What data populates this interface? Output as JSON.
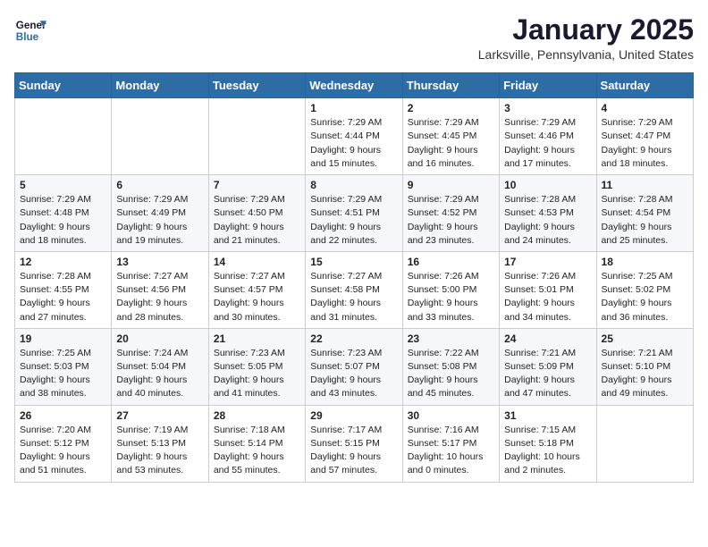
{
  "header": {
    "logo_line1": "General",
    "logo_line2": "Blue",
    "month": "January 2025",
    "location": "Larksville, Pennsylvania, United States"
  },
  "weekdays": [
    "Sunday",
    "Monday",
    "Tuesday",
    "Wednesday",
    "Thursday",
    "Friday",
    "Saturday"
  ],
  "weeks": [
    [
      {
        "day": "",
        "sunrise": "",
        "sunset": "",
        "daylight": ""
      },
      {
        "day": "",
        "sunrise": "",
        "sunset": "",
        "daylight": ""
      },
      {
        "day": "",
        "sunrise": "",
        "sunset": "",
        "daylight": ""
      },
      {
        "day": "1",
        "sunrise": "7:29 AM",
        "sunset": "4:44 PM",
        "daylight": "9 hours and 15 minutes."
      },
      {
        "day": "2",
        "sunrise": "7:29 AM",
        "sunset": "4:45 PM",
        "daylight": "9 hours and 16 minutes."
      },
      {
        "day": "3",
        "sunrise": "7:29 AM",
        "sunset": "4:46 PM",
        "daylight": "9 hours and 17 minutes."
      },
      {
        "day": "4",
        "sunrise": "7:29 AM",
        "sunset": "4:47 PM",
        "daylight": "9 hours and 18 minutes."
      }
    ],
    [
      {
        "day": "5",
        "sunrise": "7:29 AM",
        "sunset": "4:48 PM",
        "daylight": "9 hours and 18 minutes."
      },
      {
        "day": "6",
        "sunrise": "7:29 AM",
        "sunset": "4:49 PM",
        "daylight": "9 hours and 19 minutes."
      },
      {
        "day": "7",
        "sunrise": "7:29 AM",
        "sunset": "4:50 PM",
        "daylight": "9 hours and 21 minutes."
      },
      {
        "day": "8",
        "sunrise": "7:29 AM",
        "sunset": "4:51 PM",
        "daylight": "9 hours and 22 minutes."
      },
      {
        "day": "9",
        "sunrise": "7:29 AM",
        "sunset": "4:52 PM",
        "daylight": "9 hours and 23 minutes."
      },
      {
        "day": "10",
        "sunrise": "7:28 AM",
        "sunset": "4:53 PM",
        "daylight": "9 hours and 24 minutes."
      },
      {
        "day": "11",
        "sunrise": "7:28 AM",
        "sunset": "4:54 PM",
        "daylight": "9 hours and 25 minutes."
      }
    ],
    [
      {
        "day": "12",
        "sunrise": "7:28 AM",
        "sunset": "4:55 PM",
        "daylight": "9 hours and 27 minutes."
      },
      {
        "day": "13",
        "sunrise": "7:27 AM",
        "sunset": "4:56 PM",
        "daylight": "9 hours and 28 minutes."
      },
      {
        "day": "14",
        "sunrise": "7:27 AM",
        "sunset": "4:57 PM",
        "daylight": "9 hours and 30 minutes."
      },
      {
        "day": "15",
        "sunrise": "7:27 AM",
        "sunset": "4:58 PM",
        "daylight": "9 hours and 31 minutes."
      },
      {
        "day": "16",
        "sunrise": "7:26 AM",
        "sunset": "5:00 PM",
        "daylight": "9 hours and 33 minutes."
      },
      {
        "day": "17",
        "sunrise": "7:26 AM",
        "sunset": "5:01 PM",
        "daylight": "9 hours and 34 minutes."
      },
      {
        "day": "18",
        "sunrise": "7:25 AM",
        "sunset": "5:02 PM",
        "daylight": "9 hours and 36 minutes."
      }
    ],
    [
      {
        "day": "19",
        "sunrise": "7:25 AM",
        "sunset": "5:03 PM",
        "daylight": "9 hours and 38 minutes."
      },
      {
        "day": "20",
        "sunrise": "7:24 AM",
        "sunset": "5:04 PM",
        "daylight": "9 hours and 40 minutes."
      },
      {
        "day": "21",
        "sunrise": "7:23 AM",
        "sunset": "5:05 PM",
        "daylight": "9 hours and 41 minutes."
      },
      {
        "day": "22",
        "sunrise": "7:23 AM",
        "sunset": "5:07 PM",
        "daylight": "9 hours and 43 minutes."
      },
      {
        "day": "23",
        "sunrise": "7:22 AM",
        "sunset": "5:08 PM",
        "daylight": "9 hours and 45 minutes."
      },
      {
        "day": "24",
        "sunrise": "7:21 AM",
        "sunset": "5:09 PM",
        "daylight": "9 hours and 47 minutes."
      },
      {
        "day": "25",
        "sunrise": "7:21 AM",
        "sunset": "5:10 PM",
        "daylight": "9 hours and 49 minutes."
      }
    ],
    [
      {
        "day": "26",
        "sunrise": "7:20 AM",
        "sunset": "5:12 PM",
        "daylight": "9 hours and 51 minutes."
      },
      {
        "day": "27",
        "sunrise": "7:19 AM",
        "sunset": "5:13 PM",
        "daylight": "9 hours and 53 minutes."
      },
      {
        "day": "28",
        "sunrise": "7:18 AM",
        "sunset": "5:14 PM",
        "daylight": "9 hours and 55 minutes."
      },
      {
        "day": "29",
        "sunrise": "7:17 AM",
        "sunset": "5:15 PM",
        "daylight": "9 hours and 57 minutes."
      },
      {
        "day": "30",
        "sunrise": "7:16 AM",
        "sunset": "5:17 PM",
        "daylight": "10 hours and 0 minutes."
      },
      {
        "day": "31",
        "sunrise": "7:15 AM",
        "sunset": "5:18 PM",
        "daylight": "10 hours and 2 minutes."
      },
      {
        "day": "",
        "sunrise": "",
        "sunset": "",
        "daylight": ""
      }
    ]
  ]
}
